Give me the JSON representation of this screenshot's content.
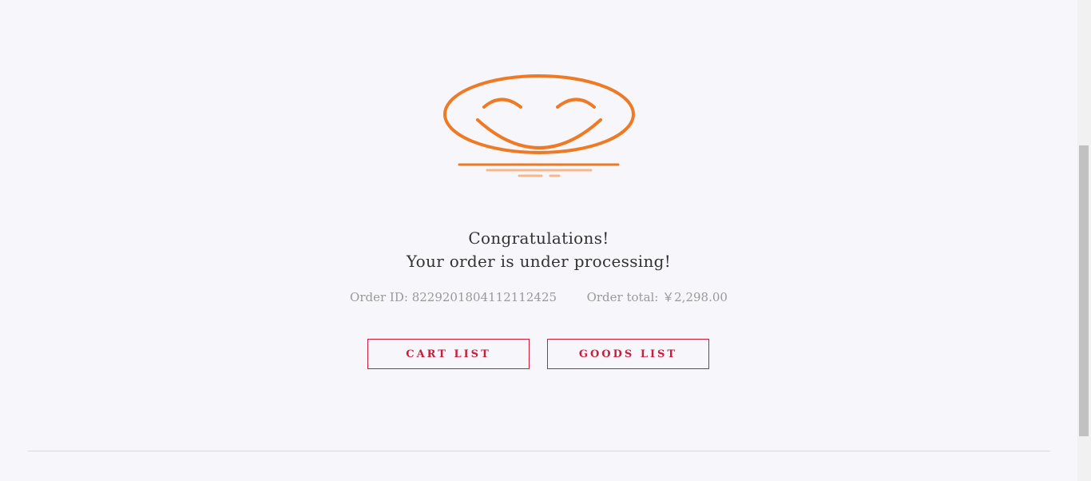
{
  "result": {
    "line1": "Congratulations!",
    "line2": "Your order is under processing!"
  },
  "order": {
    "id_label": "Order ID:",
    "id_value": "8229201804112112425",
    "total_label": "Order total:",
    "total_value": "￥2,298.00"
  },
  "actions": {
    "cart_label": "CART LIST",
    "goods_label": "GOODS LIST"
  },
  "illustration": {
    "icon": "smiley-face-icon",
    "color": "#ee7a26",
    "shadow_color": "#f5b88c"
  },
  "colors": {
    "background": "#f7f7fb",
    "accent": "#c81e3c",
    "text": "#333333",
    "muted_text": "#999999"
  }
}
